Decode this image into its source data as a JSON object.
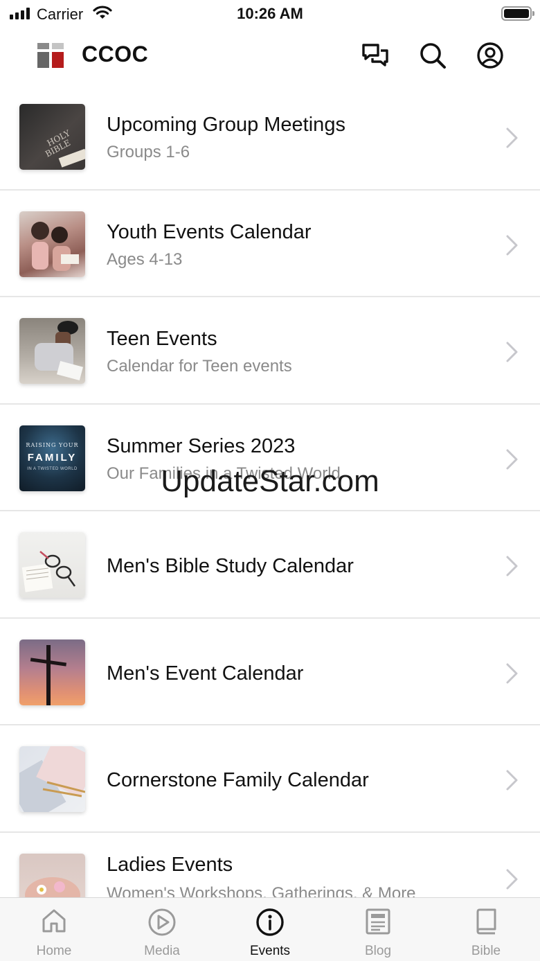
{
  "status_bar": {
    "carrier": "Carrier",
    "time": "10:26 AM"
  },
  "header": {
    "title": "CCOC",
    "icons": [
      "chat-icon",
      "search-icon",
      "account-icon"
    ],
    "logo_colors": [
      "#666666",
      "#b51c1c",
      "#c4c4c4"
    ]
  },
  "list": {
    "items": [
      {
        "title": "Upcoming Group Meetings",
        "subtitle": "Groups 1-6",
        "thumbnail": "holy-bible"
      },
      {
        "title": "Youth Events Calendar",
        "subtitle": "Ages 4-13",
        "thumbnail": "children-reading"
      },
      {
        "title": "Teen Events",
        "subtitle": "Calendar for Teen events",
        "thumbnail": "teen-writing"
      },
      {
        "title": "Summer Series 2023",
        "subtitle": "Our Families in a Twisted World",
        "thumbnail": "raising-your-family",
        "thumbnail_text": [
          "RAISING YOUR",
          "FAMILY",
          "IN A TWISTED WORLD"
        ]
      },
      {
        "title": "Men's Bible Study Calendar",
        "subtitle": "",
        "thumbnail": "bible-glasses"
      },
      {
        "title": "Men's Event Calendar",
        "subtitle": "",
        "thumbnail": "cross-sunset"
      },
      {
        "title": "Cornerstone Family Calendar",
        "subtitle": "",
        "thumbnail": "notebook-pencil"
      },
      {
        "title": "Ladies Events",
        "subtitle": "Women's Workshops, Gatherings, & More",
        "thumbnail": "hands-flowers"
      }
    ]
  },
  "watermark": "UpdateStar.com",
  "tab_bar": {
    "active": "Events",
    "tabs": [
      {
        "label": "Home",
        "icon": "home-icon"
      },
      {
        "label": "Media",
        "icon": "play-icon"
      },
      {
        "label": "Events",
        "icon": "info-icon"
      },
      {
        "label": "Blog",
        "icon": "blog-icon"
      },
      {
        "label": "Bible",
        "icon": "book-icon"
      }
    ]
  },
  "colors": {
    "accent": "#111111",
    "inactive": "#9a9a9a",
    "divider": "#e6e6e6",
    "brand_red": "#b51c1c"
  }
}
